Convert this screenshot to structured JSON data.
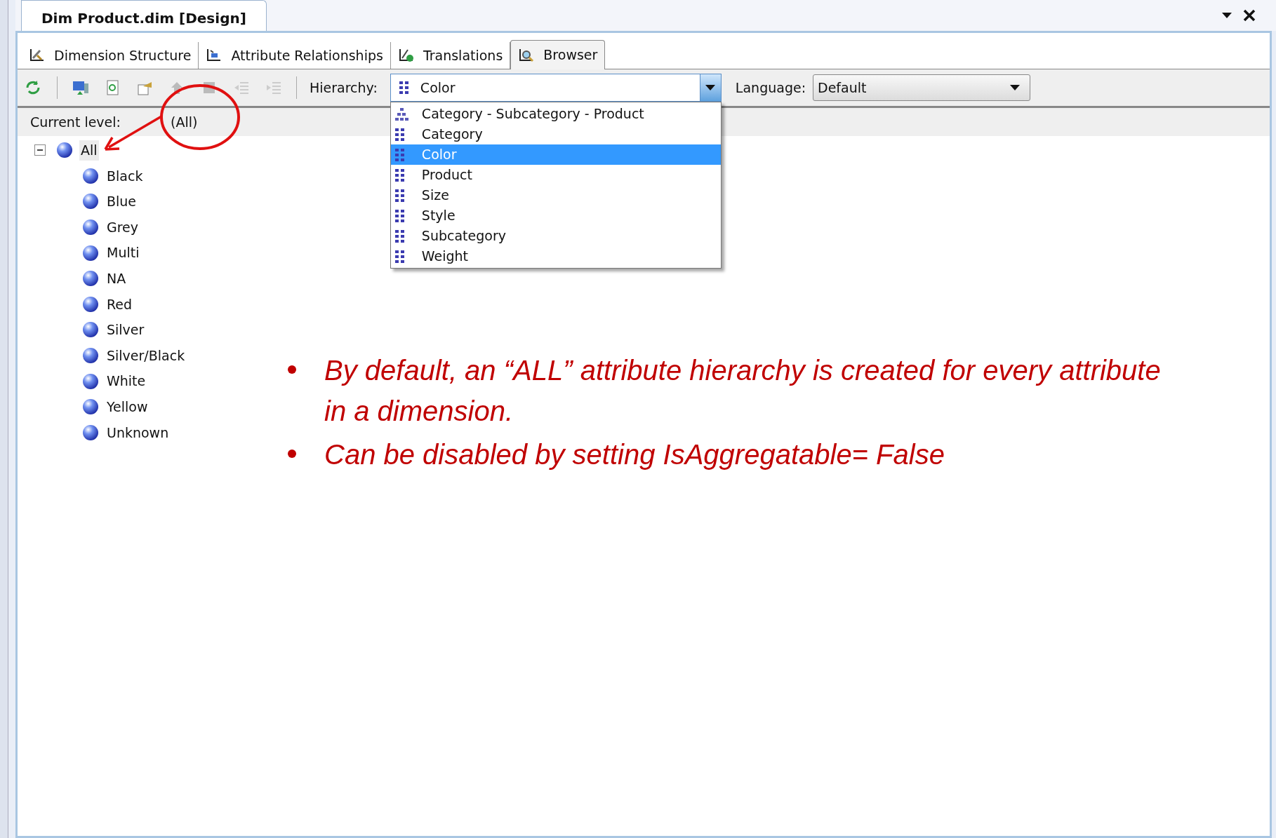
{
  "document_tab": {
    "title": "Dim Product.dim [Design]"
  },
  "designer_tabs": [
    {
      "label": "Dimension Structure",
      "selected": false
    },
    {
      "label": "Attribute Relationships",
      "selected": false
    },
    {
      "label": "Translations",
      "selected": false
    },
    {
      "label": "Browser",
      "selected": true
    }
  ],
  "toolbar": {
    "hierarchy_label": "Hierarchy:",
    "hierarchy_value": "Color",
    "language_label": "Language:",
    "language_value": "Default"
  },
  "hierarchy_dropdown": [
    {
      "label": "Category - Subcategory - Product",
      "kind": "user",
      "selected": false
    },
    {
      "label": "Category",
      "kind": "attribute",
      "selected": false
    },
    {
      "label": "Color",
      "kind": "attribute",
      "selected": true
    },
    {
      "label": "Product",
      "kind": "attribute",
      "selected": false
    },
    {
      "label": "Size",
      "kind": "attribute",
      "selected": false
    },
    {
      "label": "Style",
      "kind": "attribute",
      "selected": false
    },
    {
      "label": "Subcategory",
      "kind": "attribute",
      "selected": false
    },
    {
      "label": "Weight",
      "kind": "attribute",
      "selected": false
    }
  ],
  "current_level": {
    "label": "Current level:",
    "value": "(All)"
  },
  "tree": [
    {
      "label": "All",
      "selected": true,
      "expanded": true,
      "children": [
        {
          "label": "Black",
          "selected": false
        },
        {
          "label": "Blue",
          "selected": false
        },
        {
          "label": "Grey",
          "selected": false
        },
        {
          "label": "Multi",
          "selected": false
        },
        {
          "label": "NA",
          "selected": false
        },
        {
          "label": "Red",
          "selected": false
        },
        {
          "label": "Silver",
          "selected": false
        },
        {
          "label": "Silver/Black",
          "selected": false
        },
        {
          "label": "White",
          "selected": false
        },
        {
          "label": "Yellow",
          "selected": false
        },
        {
          "label": "Unknown",
          "selected": false
        }
      ]
    }
  ],
  "annotation_bullets": [
    "By default, an “ALL” attribute hierarchy is created for every attribute in a dimension.",
    "Can be disabled by setting IsAggregatable= False"
  ]
}
